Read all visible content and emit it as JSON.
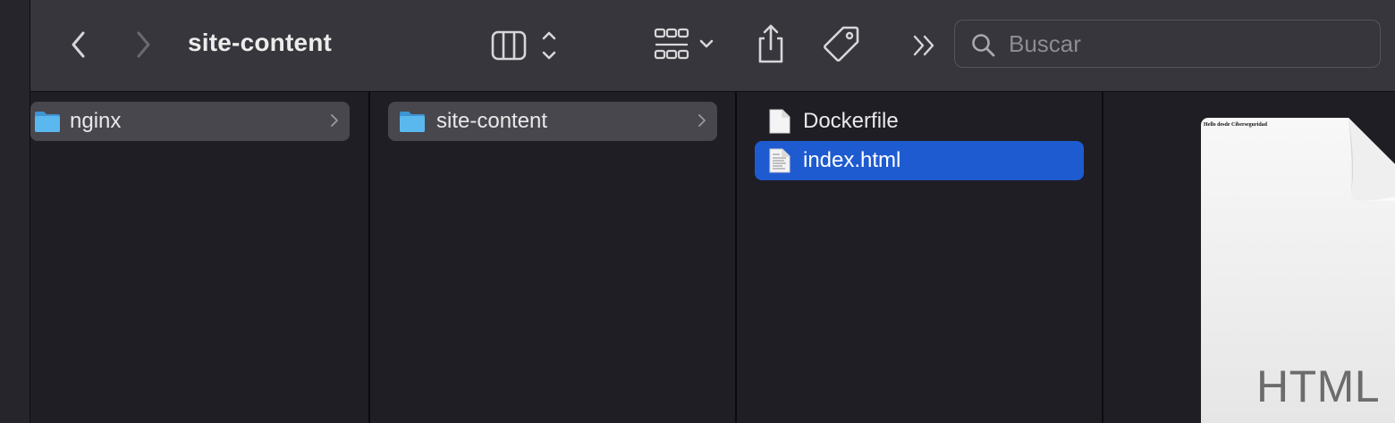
{
  "window": {
    "title": "site-content"
  },
  "toolbar": {
    "back_icon": "chevron-left-icon",
    "forward_icon": "chevron-right-icon",
    "view_icon": "columns-view-icon",
    "group_icon": "grid-group-icon",
    "share_icon": "share-icon",
    "tag_icon": "tag-icon",
    "more_icon": "double-chevron-right-icon"
  },
  "search": {
    "placeholder": "Buscar",
    "value": ""
  },
  "columns": [
    {
      "items": [
        {
          "label": "nginx",
          "kind": "folder",
          "state": "parent-selected",
          "has_children": true
        }
      ]
    },
    {
      "items": [
        {
          "label": "site-content",
          "kind": "folder",
          "state": "parent-selected",
          "has_children": true
        }
      ]
    },
    {
      "items": [
        {
          "label": "Dockerfile",
          "kind": "file",
          "state": "normal",
          "has_children": false
        },
        {
          "label": "index.html",
          "kind": "html-file",
          "state": "selected",
          "has_children": false
        }
      ]
    }
  ],
  "preview": {
    "content_text": "Hello desde Ciberseguridad",
    "type_label": "HTML"
  },
  "colors": {
    "toolbar_bg": "#37363c",
    "column_bg": "#1f1e25",
    "selection_blue": "#1f5bd0",
    "parent_selection": "#48474d",
    "folder_blue": "#4fb0ea"
  }
}
